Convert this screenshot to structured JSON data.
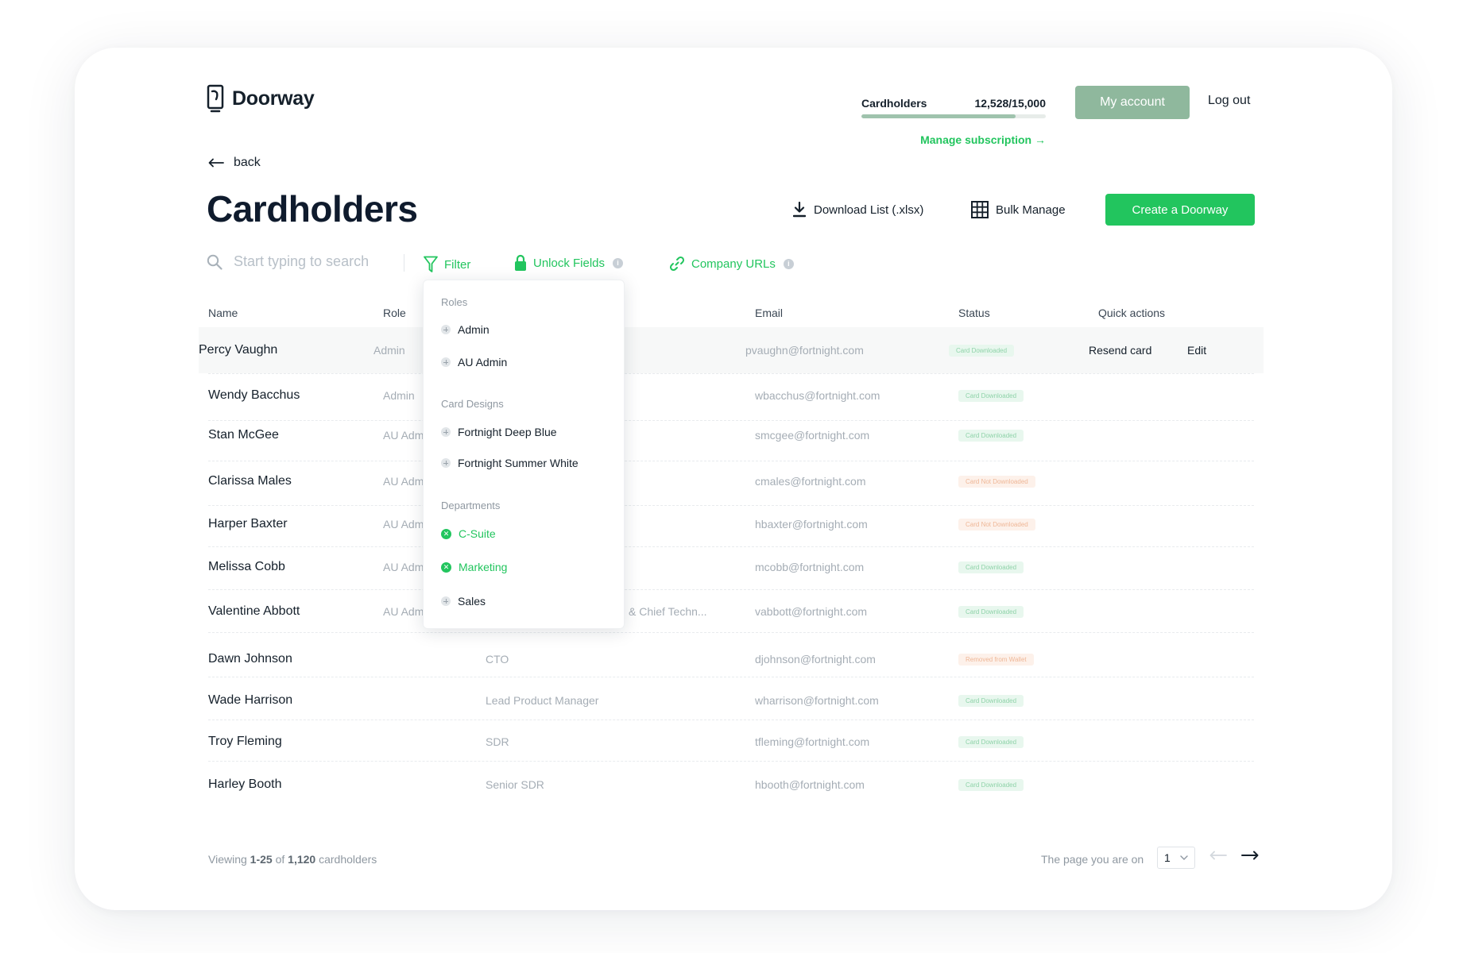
{
  "app": {
    "name": "Doorway",
    "logo_icon": "doorway-logo-icon"
  },
  "header": {
    "quota_label": "Cardholders",
    "quota_value": "12,528/15,000",
    "quota_fraction": 0.835,
    "manage_subscription": "Manage subscription →",
    "my_account": "My account",
    "logout": "Log out",
    "accent_color": "#22c55e",
    "account_button_color": "#8fb89d"
  },
  "nav": {
    "back": "back"
  },
  "page": {
    "title": "Cardholders",
    "download": "Download List (.xlsx)",
    "bulk": "Bulk Manage",
    "create": "Create a Doorway"
  },
  "toolbar": {
    "search_placeholder": "Start typing to search",
    "filter": "Filter",
    "unlock": "Unlock Fields",
    "urls": "Company URLs"
  },
  "table": {
    "columns": {
      "name": "Name",
      "role": "Role",
      "email": "Email",
      "status": "Status",
      "actions": "Quick actions"
    },
    "rows": [
      {
        "name": "Percy Vaughn",
        "role": "Admin",
        "title": "",
        "email": "pvaughn@fortnight.com",
        "status": "Card Downloaded",
        "status_color": "green",
        "resend": "Resend card",
        "edit": "Edit"
      },
      {
        "name": "Wendy Bacchus",
        "role": "Admin",
        "title": "",
        "email": "wbacchus@fortnight.com",
        "status": "Card Downloaded",
        "status_color": "green"
      },
      {
        "name": "Stan McGee",
        "role": "AU Adm",
        "title": "",
        "email": "smcgee@fortnight.com",
        "status": "Card Downloaded",
        "status_color": "green"
      },
      {
        "name": "Clarissa Males",
        "role": "AU Adm",
        "title": "",
        "email": "cmales@fortnight.com",
        "status": "Card Not Downloaded",
        "status_color": "orange"
      },
      {
        "name": "Harper Baxter",
        "role": "AU Adm",
        "title": "",
        "email": "hbaxter@fortnight.com",
        "status": "Card Not Downloaded",
        "status_color": "orange"
      },
      {
        "name": "Melissa Cobb",
        "role": "AU Adm",
        "title": "",
        "email": "mcobb@fortnight.com",
        "status": "Card Downloaded",
        "status_color": "green"
      },
      {
        "name": "Valentine Abbott",
        "role": "AU Adm",
        "title": "& Chief Techn...",
        "email": "vabbott@fortnight.com",
        "status": "Card Downloaded",
        "status_color": "green"
      },
      {
        "name": "Dawn Johnson",
        "role": "",
        "title": "CTO",
        "email": "djohnson@fortnight.com",
        "status": "Removed from Wallet",
        "status_color": "orange"
      },
      {
        "name": "Wade Harrison",
        "role": "",
        "title": "Lead Product Manager",
        "email": "wharrison@fortnight.com",
        "status": "Card Downloaded",
        "status_color": "green"
      },
      {
        "name": "Troy Fleming",
        "role": "",
        "title": "SDR",
        "email": "tfleming@fortnight.com",
        "status": "Card Downloaded",
        "status_color": "green"
      },
      {
        "name": "Harley Booth",
        "role": "",
        "title": "Senior SDR",
        "email": "hbooth@fortnight.com",
        "status": "Card Downloaded",
        "status_color": "green"
      }
    ]
  },
  "filter_dropdown": {
    "roles_heading": "Roles",
    "roles": [
      {
        "label": "Admin",
        "selected": false
      },
      {
        "label": "AU Admin",
        "selected": false
      }
    ],
    "designs_heading": "Card Designs",
    "designs": [
      {
        "label": "Fortnight Deep Blue",
        "selected": false
      },
      {
        "label": "Fortnight Summer White",
        "selected": false
      }
    ],
    "departments_heading": "Departments",
    "departments": [
      {
        "label": "C-Suite",
        "selected": true
      },
      {
        "label": "Marketing",
        "selected": true
      },
      {
        "label": "Sales",
        "selected": false
      }
    ]
  },
  "footer": {
    "viewing_prefix": "Viewing",
    "viewing_range": "1-25",
    "viewing_of": "of",
    "viewing_total": "1,120",
    "viewing_suffix": "cardholders",
    "page_label": "The page you are on",
    "page_value": "1"
  }
}
